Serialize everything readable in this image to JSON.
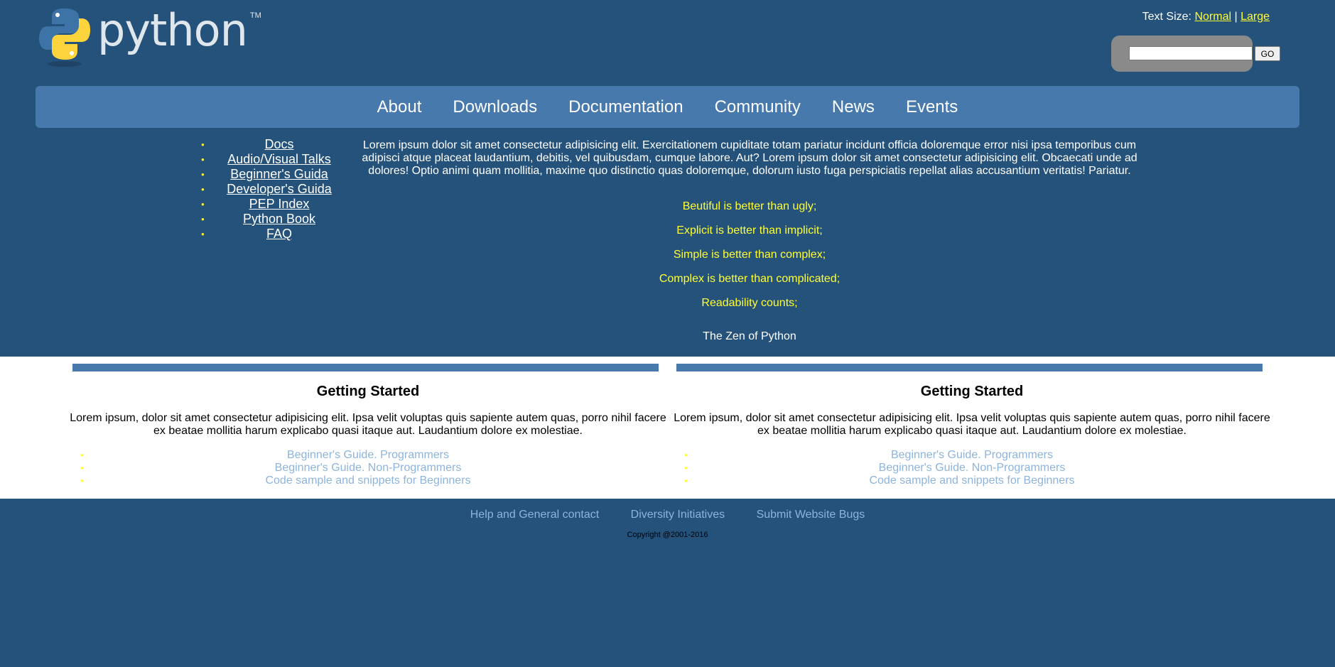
{
  "header": {
    "logo_text": "python",
    "logo_tm": "TM",
    "text_size_label": "Text Size:",
    "text_size_normal": "Normal",
    "text_size_separator": "|",
    "text_size_large": "Large",
    "search_value": "",
    "go_label": "GO"
  },
  "nav": {
    "items": [
      "About",
      "Downloads",
      "Documentation",
      "Community",
      "News",
      "Events"
    ]
  },
  "sidebar": {
    "links": [
      "Docs",
      "Audio/Visual Talks",
      "Beginner's Guida",
      "Developer's Guida",
      "PEP Index",
      "Python Book",
      "FAQ"
    ]
  },
  "intro": {
    "text": "Lorem ipsum dolor sit amet consectetur adipisicing elit. Exercitationem cupiditate totam pariatur incidunt officia doloremque error nisi ipsa temporibus cum adipisci atque placeat laudantium, debitis, vel quibusdam, cumque labore. Aut? Lorem ipsum dolor sit amet consectetur adipisicing elit. Obcaecati unde ad dolores! Optio animi quam mollitia, maxime quo distinctio quas doloremque, dolorum iusto fuga perspiciatis repellat alias accusantium veritatis! Pariatur."
  },
  "zen": {
    "lines": [
      "Beutiful is better than ugly;",
      "Explicit is better than implicit;",
      "Simple is better than complex;",
      "Complex is better than complicated;",
      "Readability counts;"
    ],
    "title": "The Zen of Python"
  },
  "columns": [
    {
      "title": "Getting Started",
      "text": "Lorem ipsum, dolor sit amet consectetur adipisicing elit. Ipsa velit voluptas quis sapiente autem quas, porro nihil facere ex beatae mollitia harum explicabo quasi itaque aut. Laudantium dolore ex molestiae.",
      "links": [
        "Beginner's Guide. Programmers",
        "Beginner's Guide. Non-Programmers",
        "Code sample and snippets for Beginners"
      ]
    },
    {
      "title": "Getting Started",
      "text": "Lorem ipsum, dolor sit amet consectetur adipisicing elit. Ipsa velit voluptas quis sapiente autem quas, porro nihil facere ex beatae mollitia harum explicabo quasi itaque aut. Laudantium dolore ex molestiae.",
      "links": [
        "Beginner's Guide. Programmers",
        "Beginner's Guide. Non-Programmers",
        "Code sample and snippets for Beginners"
      ]
    }
  ],
  "footer": {
    "links": [
      "Help and General contact",
      "Diversity Initiatives",
      "Submit Website Bugs"
    ],
    "copyright": "Copyright @2001-2016"
  },
  "colors": {
    "background": "#25527a",
    "nav": "#4779ad",
    "accent_yellow": "#ffff33",
    "link_light_blue": "#8db4dc"
  }
}
